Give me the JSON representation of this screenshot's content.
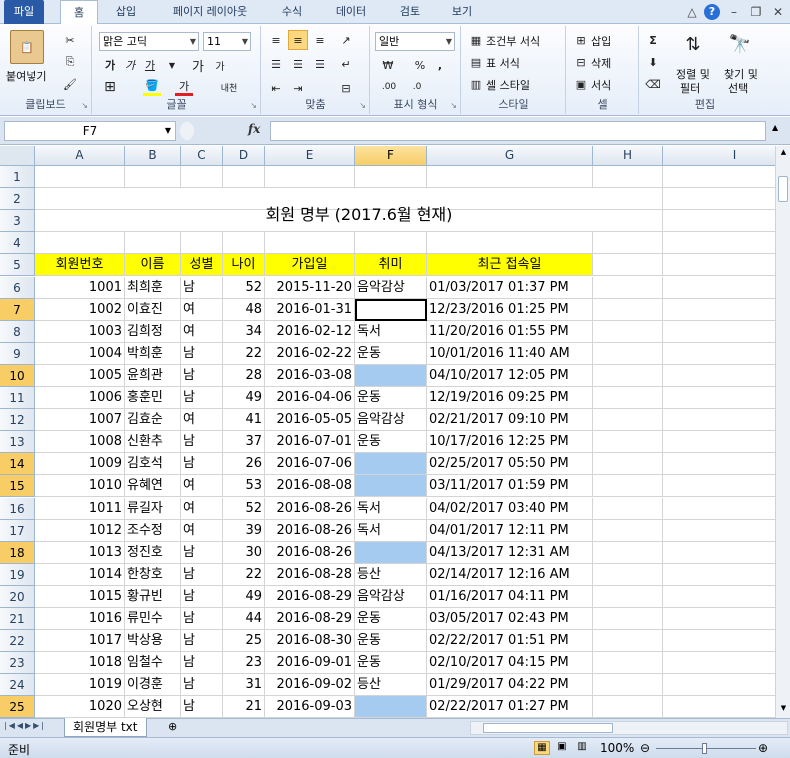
{
  "tabs": [
    "파일",
    "홈",
    "삽입",
    "페이지 레이아웃",
    "수식",
    "데이터",
    "검토",
    "보기"
  ],
  "ribbon": {
    "clipboard": {
      "label": "클립보드",
      "paste": "붙여넣기"
    },
    "font": {
      "label": "글꼴",
      "name": "맑은 고딕",
      "size": "11",
      "bold": "가",
      "italic": "가",
      "underline": "가",
      "grow": "가",
      "shrink": "가",
      "color_char": "가",
      "phonetic": "내천"
    },
    "align": {
      "label": "맞춤"
    },
    "number": {
      "label": "표시 형식",
      "format": "일반"
    },
    "styles": {
      "label": "스타일",
      "cond": "조건부 서식",
      "table": "표 서식",
      "cell": "셀 스타일"
    },
    "cells": {
      "label": "셀",
      "insert": "삽입",
      "delete": "삭제",
      "format": "서식"
    },
    "edit": {
      "label": "편집",
      "sort": "정렬 및",
      "sort2": "필터",
      "find": "찾기 및",
      "find2": "선택"
    }
  },
  "formula_bar": {
    "name_box": "F7",
    "fx": "fx"
  },
  "columns": [
    "A",
    "B",
    "C",
    "D",
    "E",
    "F",
    "G",
    "H",
    "I"
  ],
  "title": "회원 명부 (2017.6월 현재)",
  "headers": [
    "회원번호",
    "이름",
    "성별",
    "나이",
    "가입일",
    "취미",
    "최근 접속일"
  ],
  "rows": [
    [
      "1001",
      "최희훈",
      "남",
      "52",
      "2015-11-20",
      "음악감상",
      "01/03/2017 01:37 PM"
    ],
    [
      "1002",
      "이효진",
      "여",
      "48",
      "2016-01-31",
      "",
      "12/23/2016 01:25 PM"
    ],
    [
      "1003",
      "김희정",
      "여",
      "34",
      "2016-02-12",
      "독서",
      "11/20/2016 01:55 PM"
    ],
    [
      "1004",
      "박희훈",
      "남",
      "22",
      "2016-02-22",
      "운동",
      "10/01/2016 11:40 AM"
    ],
    [
      "1005",
      "윤희관",
      "남",
      "28",
      "2016-03-08",
      "",
      "04/10/2017 12:05 PM"
    ],
    [
      "1006",
      "홍훈민",
      "남",
      "49",
      "2016-04-06",
      "운동",
      "12/19/2016 09:25 PM"
    ],
    [
      "1007",
      "김효순",
      "여",
      "41",
      "2016-05-05",
      "음악감상",
      "02/21/2017 09:10 PM"
    ],
    [
      "1008",
      "신환추",
      "남",
      "37",
      "2016-07-01",
      "운동",
      "10/17/2016 12:25 PM"
    ],
    [
      "1009",
      "김호석",
      "남",
      "26",
      "2016-07-06",
      "",
      "02/25/2017 05:50 PM"
    ],
    [
      "1010",
      "유혜연",
      "여",
      "53",
      "2016-08-08",
      "",
      "03/11/2017 01:59 PM"
    ],
    [
      "1011",
      "류길자",
      "여",
      "52",
      "2016-08-26",
      "독서",
      "04/02/2017 03:40 PM"
    ],
    [
      "1012",
      "조수정",
      "여",
      "39",
      "2016-08-26",
      "독서",
      "04/01/2017 12:11 PM"
    ],
    [
      "1013",
      "정진호",
      "남",
      "30",
      "2016-08-26",
      "",
      "04/13/2017 12:31 AM"
    ],
    [
      "1014",
      "한창호",
      "남",
      "22",
      "2016-08-28",
      "등산",
      "02/14/2017 12:16 AM"
    ],
    [
      "1015",
      "황규빈",
      "남",
      "49",
      "2016-08-29",
      "음악감상",
      "01/16/2017 04:11 PM"
    ],
    [
      "1016",
      "류민수",
      "남",
      "44",
      "2016-08-29",
      "운동",
      "03/05/2017 02:43 PM"
    ],
    [
      "1017",
      "박상용",
      "남",
      "25",
      "2016-08-30",
      "운동",
      "02/22/2017 01:51 PM"
    ],
    [
      "1018",
      "임철수",
      "남",
      "23",
      "2016-09-01",
      "운동",
      "02/10/2017 04:15 PM"
    ],
    [
      "1019",
      "이경훈",
      "남",
      "31",
      "2016-09-02",
      "등산",
      "01/29/2017 04:22 PM"
    ],
    [
      "1020",
      "오상현",
      "남",
      "21",
      "2016-09-03",
      "",
      "02/22/2017 01:27 PM"
    ]
  ],
  "blue_rows": [
    10,
    14,
    15,
    18,
    25
  ],
  "sheet_tab": "회원명부 txt",
  "status": {
    "ready": "준비",
    "zoom": "100%"
  },
  "colors": {
    "header_fill": "#ffff00",
    "highlight_fill": "#a6cbf0",
    "selected_header": "#f8cd66"
  }
}
